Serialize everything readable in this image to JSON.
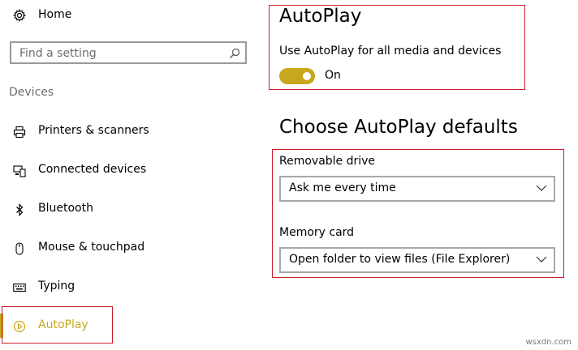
{
  "sidebar": {
    "home_label": "Home",
    "search_placeholder": "Find a setting",
    "section_label": "Devices",
    "items": [
      {
        "label": "Printers & scanners",
        "icon": "printer-icon"
      },
      {
        "label": "Connected devices",
        "icon": "connected-devices-icon"
      },
      {
        "label": "Bluetooth",
        "icon": "bluetooth-icon"
      },
      {
        "label": "Mouse & touchpad",
        "icon": "mouse-icon"
      },
      {
        "label": "Typing",
        "icon": "keyboard-icon"
      },
      {
        "label": "AutoPlay",
        "icon": "autoplay-icon",
        "selected": true
      }
    ]
  },
  "main": {
    "title": "AutoPlay",
    "toggle_label": "Use AutoPlay for all media and devices",
    "toggle_state": "On",
    "defaults_title": "Choose AutoPlay defaults",
    "removable_drive_label": "Removable drive",
    "removable_drive_value": "Ask me every time",
    "memory_card_label": "Memory card",
    "memory_card_value": "Open folder to view files (File Explorer)"
  },
  "watermark": "wsxdn.com",
  "colors": {
    "accent": "#c8a71e",
    "highlight_border": "#c8202a",
    "muted_text": "#6d6d6d"
  }
}
